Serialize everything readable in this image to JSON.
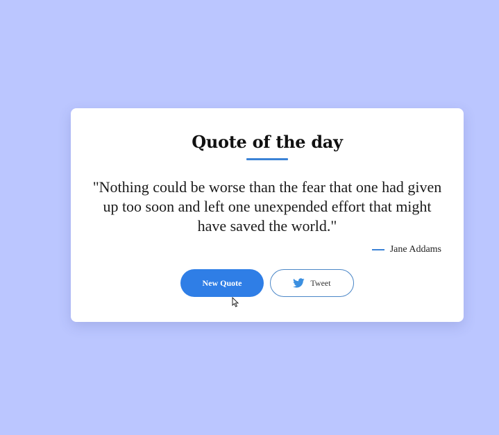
{
  "card": {
    "title": "Quote of the day",
    "quote": "\"Nothing could be worse than the fear that one had given up too soon and left one unexpended effort that might have saved the world.\"",
    "author": "Jane Addams"
  },
  "buttons": {
    "new_quote_label": "New Quote",
    "tweet_label": "Tweet",
    "tweet_icon": "twitter-icon"
  },
  "colors": {
    "background": "#bbc6ff",
    "accent": "#2f7ee6",
    "card": "#ffffff"
  }
}
